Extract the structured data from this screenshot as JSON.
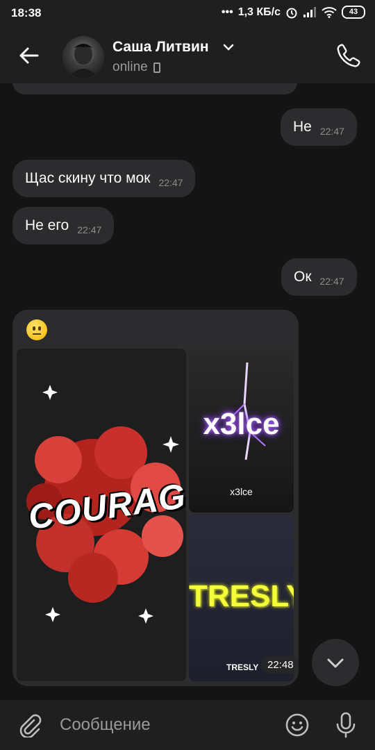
{
  "status_bar": {
    "time": "18:38",
    "network_speed": "1,3 КБ/с",
    "battery": "43"
  },
  "header": {
    "contact_name": "Саша Литвин",
    "presence": "online"
  },
  "messages": [
    {
      "direction": "out",
      "text": "Не",
      "time": "22:47"
    },
    {
      "direction": "in",
      "text": "Щас скину что мок",
      "time": "22:47"
    },
    {
      "direction": "in",
      "text": "Не его",
      "time": "22:47"
    },
    {
      "direction": "out",
      "text": "Ок",
      "time": "22:47"
    }
  ],
  "media_message": {
    "time": "22:48",
    "images": [
      {
        "caption": "COURAGE"
      },
      {
        "caption": "x3lce",
        "subcaption": "x3lce"
      },
      {
        "caption": "TRESLY",
        "subcaption": "TRESLY"
      }
    ]
  },
  "composer": {
    "placeholder": "Сообщение"
  },
  "colors": {
    "background": "#141414",
    "bar": "#1f1f1f",
    "bubble": "#2c2c2e",
    "secondary_text": "#9a9a9a"
  },
  "icons": [
    "back-arrow-icon",
    "chevron-down-icon",
    "phone-call-icon",
    "attach-clip-icon",
    "emoji-icon",
    "microphone-icon",
    "scroll-down-chevron-icon"
  ]
}
